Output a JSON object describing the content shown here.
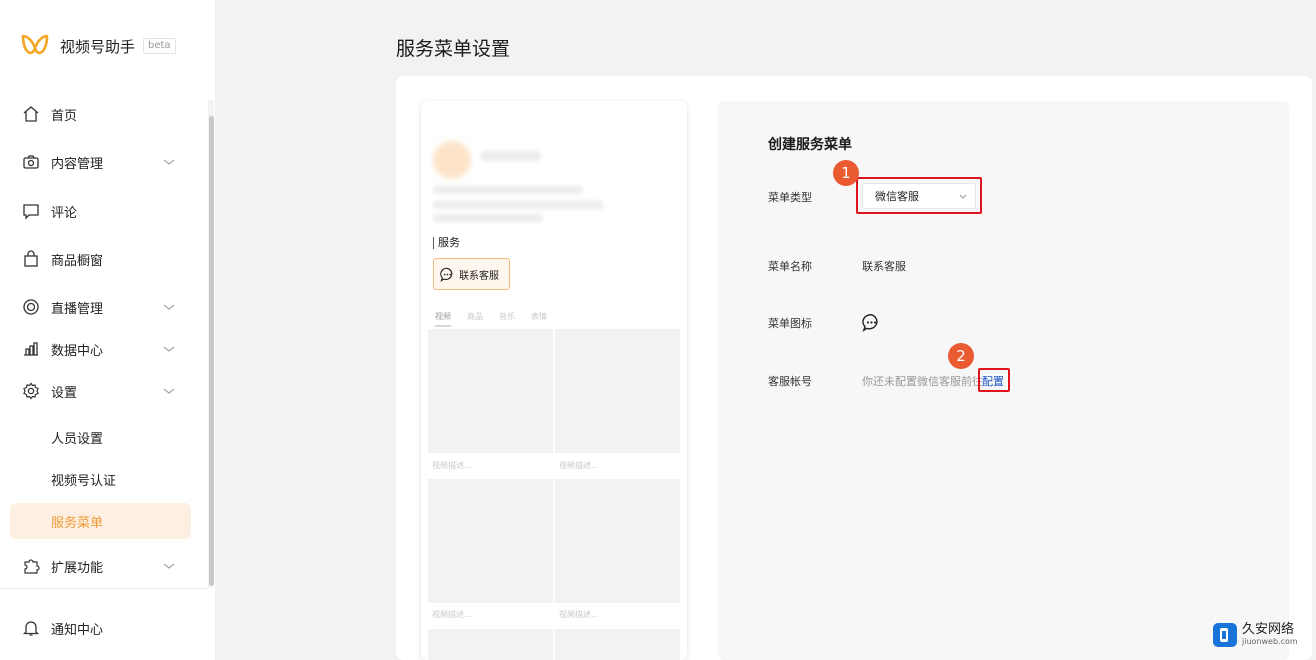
{
  "app": {
    "name": "视频号助手",
    "badge": "beta"
  },
  "sidebar": {
    "items": [
      {
        "label": "首页",
        "icon": "home-icon"
      },
      {
        "label": "内容管理",
        "icon": "camera-icon",
        "expandable": true
      },
      {
        "label": "评论",
        "icon": "comment-icon"
      },
      {
        "label": "商品橱窗",
        "icon": "shopping-bag-icon"
      },
      {
        "label": "直播管理",
        "icon": "live-icon",
        "expandable": true
      },
      {
        "label": "数据中心",
        "icon": "bar-chart-icon",
        "expandable": true
      },
      {
        "label": "设置",
        "icon": "gear-icon",
        "expandable": true,
        "expanded": true
      },
      {
        "label": "扩展功能",
        "icon": "puzzle-icon",
        "expandable": true
      }
    ],
    "settings_sub": [
      {
        "label": "人员设置"
      },
      {
        "label": "视频号认证"
      },
      {
        "label": "服务菜单",
        "active": true
      }
    ],
    "notification": {
      "label": "通知中心",
      "icon": "bell-icon"
    }
  },
  "page": {
    "title": "服务菜单设置"
  },
  "preview": {
    "section_title": "服务",
    "service_button": "联系客服",
    "tabs": [
      "视频",
      "商品",
      "音乐",
      "表情"
    ],
    "tile_caption": "视频描述..."
  },
  "form": {
    "title": "创建服务菜单",
    "menu_type": {
      "label": "菜单类型",
      "value": "微信客服"
    },
    "menu_name": {
      "label": "菜单名称",
      "value": "联系客服"
    },
    "menu_icon": {
      "label": "菜单图标",
      "icon": "chat-bubble-icon"
    },
    "service_account": {
      "label": "客服帐号",
      "hint": "你还未配置微信客服前往",
      "link": "配置"
    }
  },
  "annotations": {
    "step1": "1",
    "step2": "2",
    "highlight_color": "#e0141e",
    "badge_color": "#ea5b32"
  },
  "watermark": {
    "name": "久安网络",
    "domain": "jiuonweb.com"
  },
  "colors": {
    "accent": "#f29a3a",
    "link": "#1a52c8"
  }
}
